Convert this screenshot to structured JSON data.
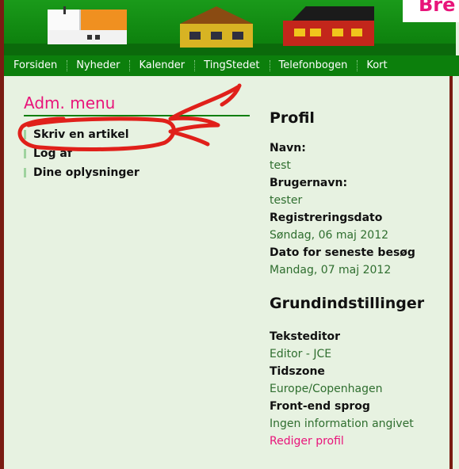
{
  "banner": {
    "brand_text": "Bre",
    "colors": {
      "banner_green": "#1a9a1a",
      "nav_green": "#0c7f0c",
      "accent_pink": "#e8147a",
      "frame_red": "#7a1c12"
    }
  },
  "nav": {
    "items": [
      "Forsiden",
      "Nyheder",
      "Kalender",
      "TingStedet",
      "Telefonbogen",
      "Kort"
    ]
  },
  "adm_menu": {
    "title": "Adm. menu",
    "items": [
      "Skriv en artikel",
      "Log af",
      "Dine oplysninger"
    ]
  },
  "profile": {
    "heading": "Profil",
    "fields": [
      {
        "label": "Navn:",
        "value": "test"
      },
      {
        "label": "Brugernavn:",
        "value": "tester"
      },
      {
        "label": "Registreringsdato",
        "value": "Søndag, 06 maj 2012"
      },
      {
        "label": "Dato for seneste besøg",
        "value": "Mandag, 07 maj 2012"
      }
    ]
  },
  "settings": {
    "heading": "Grundindstillinger",
    "fields": [
      {
        "label": "Teksteditor",
        "value": "Editor - JCE"
      },
      {
        "label": "Tidszone",
        "value": "Europe/Copenhagen"
      },
      {
        "label": "Front-end sprog",
        "value": "Ingen information angivet"
      }
    ],
    "edit_link": "Rediger profil"
  }
}
